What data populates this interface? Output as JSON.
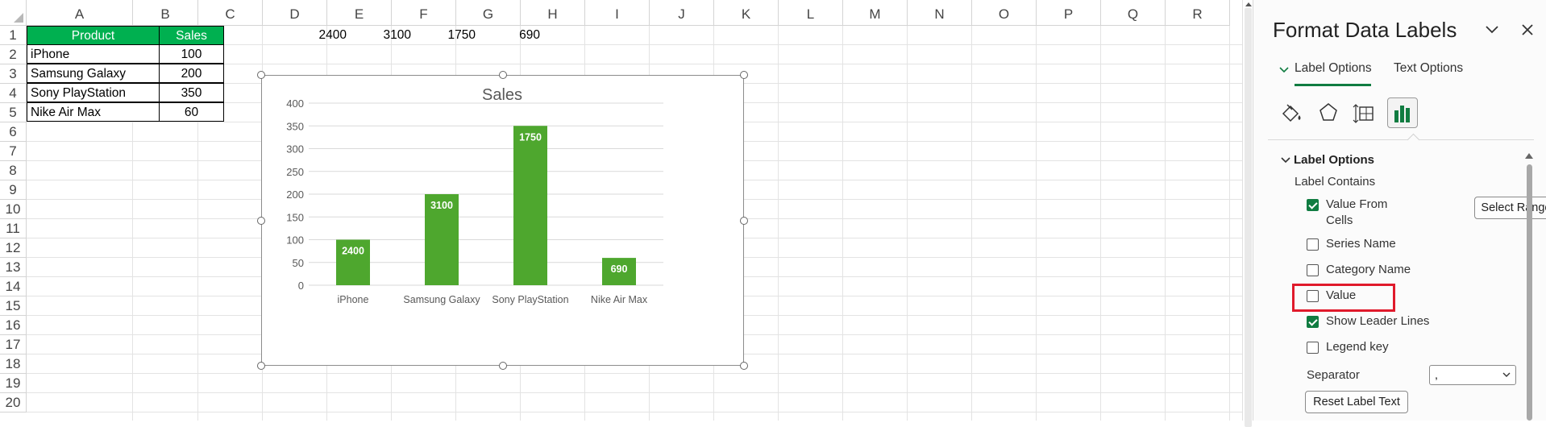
{
  "sheet": {
    "columns": [
      "A",
      "B",
      "C",
      "D",
      "E",
      "F",
      "G",
      "H",
      "I",
      "J",
      "K",
      "L",
      "M",
      "N",
      "O",
      "P",
      "Q",
      "R"
    ],
    "rows": [
      "1",
      "2",
      "3",
      "4",
      "5",
      "6",
      "7",
      "8",
      "9",
      "10",
      "11",
      "12",
      "13",
      "14",
      "15",
      "16",
      "17",
      "18",
      "19",
      "20"
    ],
    "table_headers": {
      "product": "Product",
      "sales": "Sales"
    },
    "table_rows": [
      {
        "product": "iPhone",
        "sales": "100"
      },
      {
        "product": "Samsung Galaxy",
        "sales": "200"
      },
      {
        "product": "Sony PlayStation",
        "sales": "350"
      },
      {
        "product": "Nike Air Max",
        "sales": "60"
      }
    ],
    "row1_values": {
      "D": "2400",
      "E": "3100",
      "F": "1750",
      "G": "690"
    }
  },
  "chart_data": {
    "type": "bar",
    "title": "Sales",
    "categories": [
      "iPhone",
      "Samsung Galaxy",
      "Sony PlayStation",
      "Nike Air Max"
    ],
    "series": [
      {
        "values": [
          100,
          200,
          350,
          60
        ]
      }
    ],
    "data_labels": [
      "2400",
      "3100",
      "1750",
      "690"
    ],
    "y_ticks": [
      "0",
      "50",
      "100",
      "150",
      "200",
      "250",
      "300",
      "350",
      "400"
    ],
    "ylim": [
      0,
      400
    ],
    "grid": true,
    "bar_color": "#4ea72e"
  },
  "pane": {
    "title": "Format Data Labels",
    "chevron_icon": "chevron-down-icon",
    "close_icon": "close-icon",
    "tabs": {
      "label_options": "Label Options",
      "text_options": "Text Options"
    },
    "section_title": "Label Options",
    "label_contains": "Label Contains",
    "options": {
      "value_from_cells_line1": "Value From",
      "value_from_cells_line2": "Cells",
      "select_range": "Select Range...",
      "series_name": "Series Name",
      "category_name": "Category Name",
      "value": "Value",
      "show_leader_lines": "Show Leader Lines",
      "legend_key": "Legend key"
    },
    "checked": {
      "value_from_cells": true,
      "series_name": false,
      "category_name": false,
      "value": false,
      "show_leader_lines": true,
      "legend_key": false
    },
    "separator_label": "Separator",
    "separator_value": ",",
    "reset_label": "Reset Label Text",
    "accent": "#107c41",
    "highlight_color": "#e01a2b"
  }
}
